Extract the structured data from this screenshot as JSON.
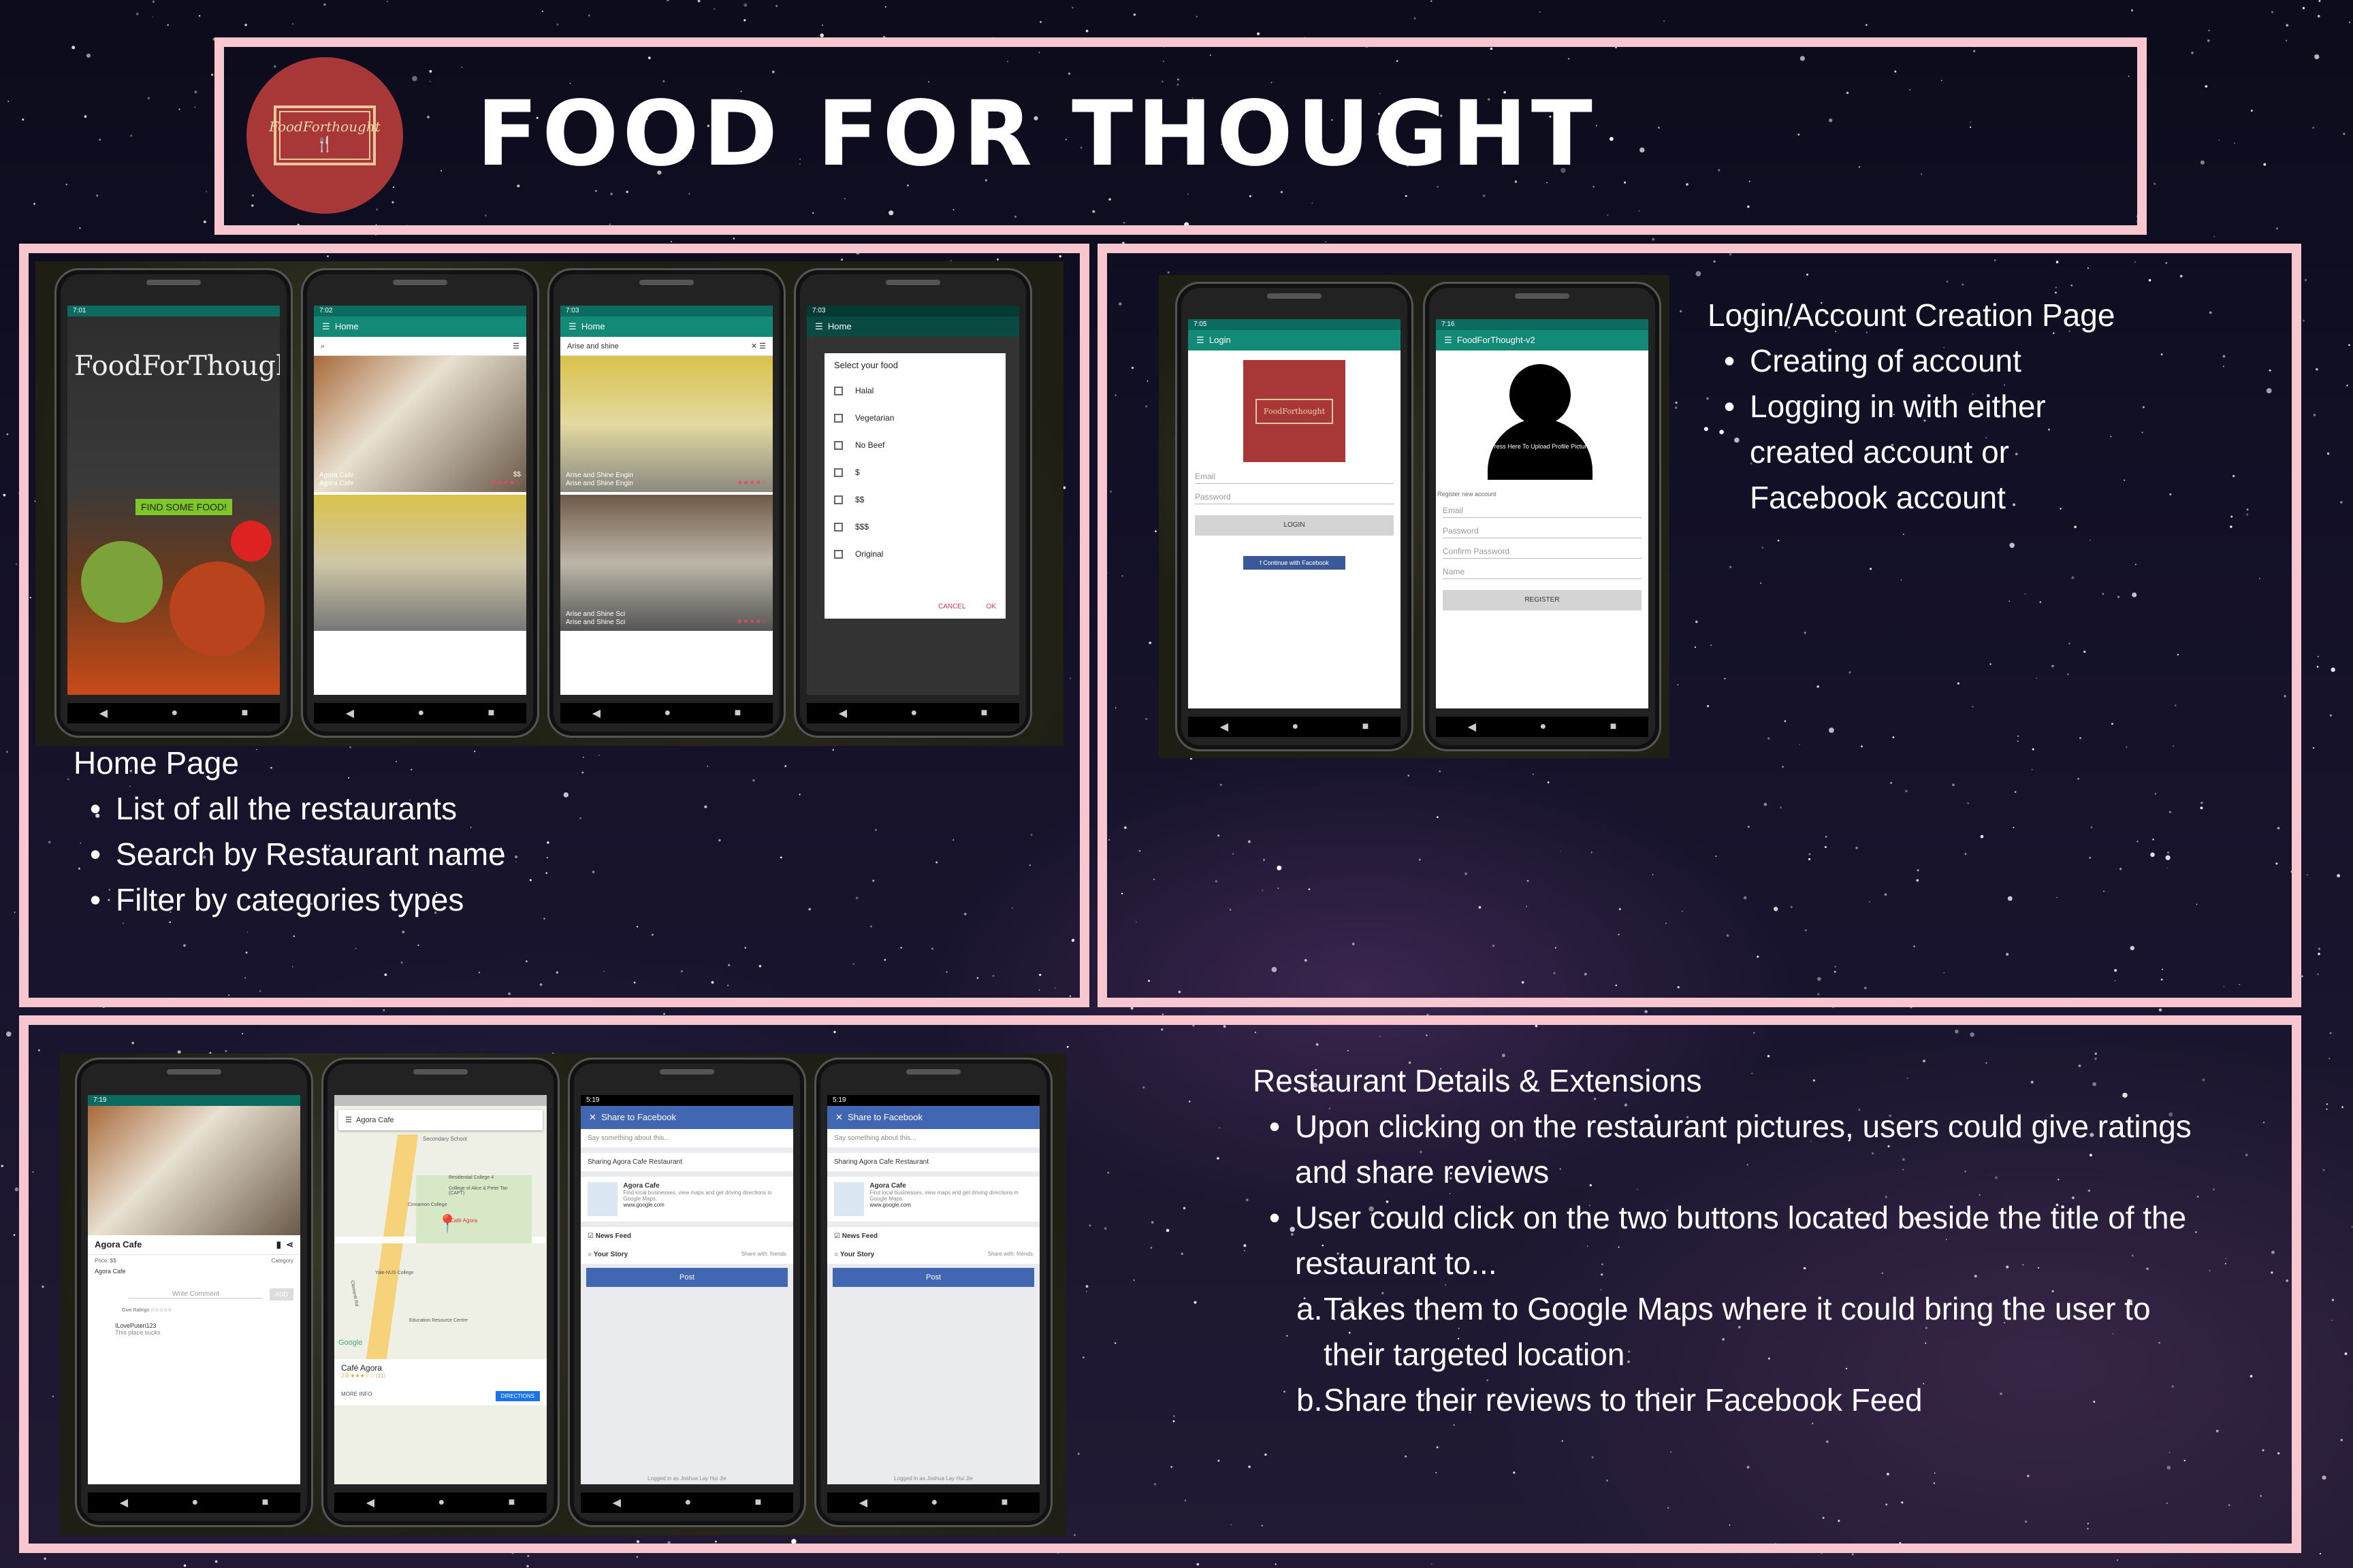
{
  "header": {
    "title": "FOOD FOR THOUGHT",
    "logo_text": "FoodForthought"
  },
  "home_section": {
    "heading": "Home Page",
    "bullets": [
      "List of all the restaurants",
      "Search by Restaurant name",
      "Filter by categories types"
    ],
    "phones": {
      "p1": {
        "time": "7:01",
        "splash_title": "FoodForThought",
        "splash_button": "FIND SOME FOOD!"
      },
      "p2": {
        "time": "7:02",
        "app_title": "Home",
        "card1": [
          "Agora Cafe",
          "Agora Cafe"
        ],
        "card1_dollar": "$$",
        "card1_stars": "★★★★☆"
      },
      "p3": {
        "time": "7:03",
        "app_title": "Home",
        "search_value": "Arise and shine",
        "card1": [
          "Arise and Shine Engin",
          "Arise and Shine Engin"
        ],
        "card2": [
          "Arise and Shine Sci",
          "Arise and Shine Sci"
        ],
        "card_stars": "★★★★☆"
      },
      "p4": {
        "time": "7:03",
        "app_title": "Home",
        "dialog_title": "Select your food",
        "options": [
          "Halal",
          "Vegetarian",
          "No Beef",
          "$",
          "$$",
          "$$$",
          "Original"
        ],
        "cancel": "CANCEL",
        "ok": "OK"
      }
    }
  },
  "login_section": {
    "heading": "Login/Account Creation Page",
    "bullets": [
      "Creating of account",
      "Logging in with either"
    ],
    "bullet_continuation": [
      "created account or",
      "Facebook account"
    ],
    "phones": {
      "p1": {
        "time": "7:05",
        "app_title": "Login",
        "logo_text": "FoodForthought",
        "email": "Email",
        "password": "Password",
        "login_btn": "LOGIN",
        "fb_btn": "Continue with Facebook"
      },
      "p2": {
        "time": "7:16",
        "app_title": "FoodForThought-v2",
        "avatar_caption": "Press Here To Upload Profile Picture",
        "register_hint": "Register new account",
        "email": "Email",
        "password": "Password",
        "confirm": "Confirm Password",
        "name": "Name",
        "register_btn": "REGISTER"
      }
    }
  },
  "details_section": {
    "heading": "Restaurant Details & Extensions",
    "bullet1": [
      "Upon clicking on the restaurant pictures, users could give ratings",
      "and share reviews"
    ],
    "bullet2": [
      "User could click on the two buttons located beside the title of the",
      "restaurant to..."
    ],
    "sub_a_marker": "a.",
    "sub_a": [
      "Takes them to Google Maps where it could bring the user to",
      "their targeted location"
    ],
    "sub_b_marker": "b.",
    "sub_b": [
      "Share their reviews to their Facebook Feed"
    ],
    "phones": {
      "p1": {
        "time": "7:19",
        "name": "Agora Cafe",
        "price": "Price: $$",
        "category": "Category",
        "sub": "Agora Cafe",
        "comment_placeholder": "Write Comment",
        "add_btn": "ADD",
        "give_ratings": "Give Ratings",
        "reviewer": "ILovePuteri123",
        "review": "This place sucks"
      },
      "p2": {
        "search": "Agora Cafe",
        "pin": "Café Agora",
        "place": "Café Agora",
        "rating": "2.8 ★★★☆☆ (11)",
        "more": "MORE INFO",
        "directions": "DIRECTIONS",
        "map_labels": [
          "Secondary School",
          "Residential College 4",
          "College of Alice & Peter Tan (CAPT)",
          "Cinnamon College",
          "Yale-NUS College",
          "Education Resource Centre",
          "Clementi Rd",
          "Google"
        ]
      },
      "p3": {
        "time": "5:19",
        "hd": "Share to Facebook",
        "say": "Say something about this...",
        "sharing": "Sharing Agora Cafe Restaurant",
        "card_title": "Agora Cafe",
        "card_desc": "Find local businesses, view maps and get driving directions in Google Maps.",
        "card_url": "www.google.com",
        "news_feed": "News Feed",
        "your_story": "Your Story",
        "share_with": "Share with: friends",
        "post": "Post",
        "logged": "Logged in as Joshua Lay Hui Jie"
      },
      "p4": {
        "time": "5:19",
        "hd": "Share to Facebook",
        "say": "Say something about this...",
        "sharing": "Sharing Agora Cafe Restaurant",
        "card_title": "Agora Cafe",
        "card_desc": "Find local businesses, view maps and get driving directions in Google Maps.",
        "card_url": "www.google.com",
        "news_feed": "News Feed",
        "your_story": "Your Story",
        "share_with": "Share with: friends",
        "post": "Post",
        "logged": "Logged in as Joshua Lay Hui Jie"
      }
    }
  },
  "colors": {
    "frame": "#f7c6cf",
    "app_teal": "#138a78",
    "logo_red": "#a83838",
    "facebook_blue": "#4267b2"
  }
}
